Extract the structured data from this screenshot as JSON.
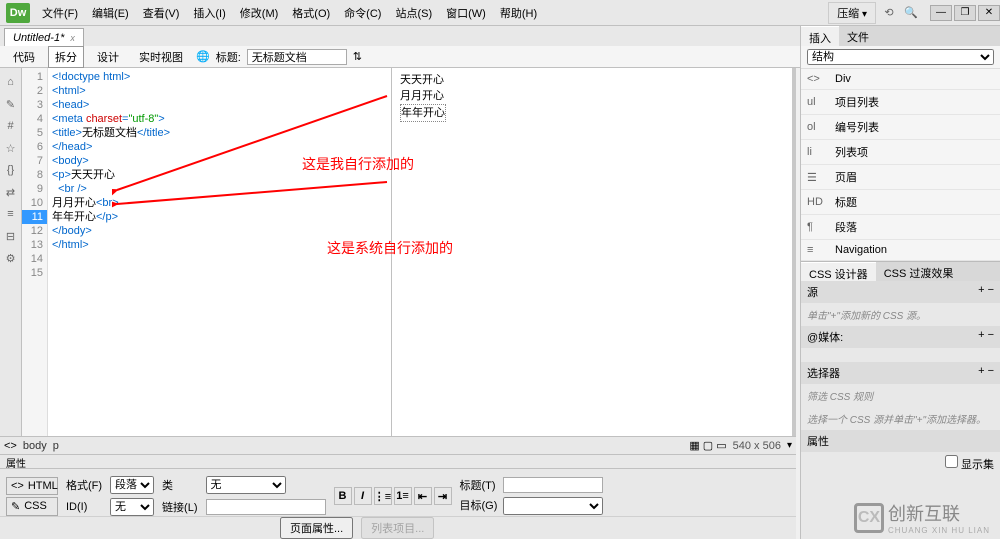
{
  "app": {
    "logo": "Dw"
  },
  "menu": {
    "file": "文件(F)",
    "edit": "编辑(E)",
    "view": "查看(V)",
    "insert": "插入(I)",
    "modify": "修改(M)",
    "format": "格式(O)",
    "commands": "命令(C)",
    "site": "站点(S)",
    "window": "窗口(W)",
    "help": "帮助(H)"
  },
  "title_right": {
    "layout": "压缩"
  },
  "doc_tab": {
    "name": "Untitled-1*",
    "close": "x"
  },
  "view_bar": {
    "code": "代码",
    "split": "拆分",
    "design": "设计",
    "live": "实时视图",
    "title_label": "标题:",
    "title_value": "无标题文档"
  },
  "gutter": [
    "1",
    "2",
    "3",
    "4",
    "5",
    "6",
    "7",
    "8",
    "9",
    "10",
    "11",
    "12",
    "13",
    "14",
    "15"
  ],
  "gutter_highlight_index": 10,
  "code_lines": [
    {
      "segs": [
        {
          "t": "<!doctype html>",
          "c": "tag"
        }
      ]
    },
    {
      "segs": [
        {
          "t": "<html>",
          "c": "tag"
        }
      ]
    },
    {
      "segs": [
        {
          "t": "<head>",
          "c": "tag"
        }
      ]
    },
    {
      "segs": [
        {
          "t": "<meta ",
          "c": "tag"
        },
        {
          "t": "charset",
          "c": "attr"
        },
        {
          "t": "=",
          "c": "tag"
        },
        {
          "t": "\"utf-8\"",
          "c": "val"
        },
        {
          "t": ">",
          "c": "tag"
        }
      ]
    },
    {
      "segs": [
        {
          "t": "<title>",
          "c": "tag"
        },
        {
          "t": "无标题文档",
          "c": "txt"
        },
        {
          "t": "</title>",
          "c": "tag"
        }
      ]
    },
    {
      "segs": [
        {
          "t": "</head>",
          "c": "tag"
        }
      ]
    },
    {
      "segs": [
        {
          "t": "",
          "c": "txt"
        }
      ]
    },
    {
      "segs": [
        {
          "t": "<body>",
          "c": "tag"
        }
      ]
    },
    {
      "segs": [
        {
          "t": "<p>",
          "c": "tag"
        },
        {
          "t": "天天开心",
          "c": "txt"
        }
      ]
    },
    {
      "segs": [
        {
          "t": "  <br />",
          "c": "tag"
        }
      ]
    },
    {
      "segs": [
        {
          "t": "月月开心",
          "c": "txt"
        },
        {
          "t": "<br>",
          "c": "tag"
        }
      ]
    },
    {
      "segs": [
        {
          "t": "年年开心",
          "c": "txt"
        },
        {
          "t": "</p>",
          "c": "tag"
        }
      ]
    },
    {
      "segs": [
        {
          "t": "</body>",
          "c": "tag"
        }
      ]
    },
    {
      "segs": [
        {
          "t": "</html>",
          "c": "tag"
        }
      ]
    },
    {
      "segs": [
        {
          "t": "",
          "c": "txt"
        }
      ]
    }
  ],
  "preview": {
    "line1": "天天开心",
    "line2": "月月开心",
    "line3": "年年开心"
  },
  "annotations": {
    "a1": "这是我自行添加的",
    "a2": "这是系统自行添加的"
  },
  "right": {
    "insert_tab": "插入",
    "files_tab": "文件",
    "struct_label": "结构",
    "items": [
      {
        "tag": "<>",
        "label": "Div"
      },
      {
        "tag": "ul",
        "label": "项目列表"
      },
      {
        "tag": "ol",
        "label": "编号列表"
      },
      {
        "tag": "li",
        "label": "列表项"
      },
      {
        "tag": "☰",
        "label": "页眉"
      },
      {
        "tag": "HD",
        "label": "标题"
      },
      {
        "tag": "¶",
        "label": "段落"
      },
      {
        "tag": "≡",
        "label": "Navigation"
      }
    ],
    "css_designer_tab": "CSS 设计器",
    "css_trans_tab": "CSS 过渡效果",
    "src_label": "源",
    "src_hint": "单击\"+\"添加新的 CSS 源。",
    "media_label": "@媒体:",
    "selector_label": "选择器",
    "selector_hint": "筛选 CSS 规则",
    "selector_hint2": "选择一个 CSS 源并单击\"+\"添加选择器。",
    "props_label": "属性",
    "show_set": "显示集"
  },
  "tagbar": {
    "body": "body",
    "p": "p",
    "dims": "540 x 506"
  },
  "props": {
    "panel_title": "属性",
    "html_btn": "HTML",
    "css_btn": "CSS",
    "format_label": "格式(F)",
    "format_value": "段落",
    "id_label": "ID(I)",
    "id_value": "无",
    "class_label": "类",
    "class_value": "无",
    "link_label": "链接(L)",
    "title_label": "标题(T)",
    "target_label": "目标(G)",
    "page_props": "页面属性...",
    "list_item": "列表项目..."
  },
  "watermark": {
    "icon": "CX",
    "text1": "创新互联",
    "text2": "CHUANG XIN HU LIAN"
  }
}
